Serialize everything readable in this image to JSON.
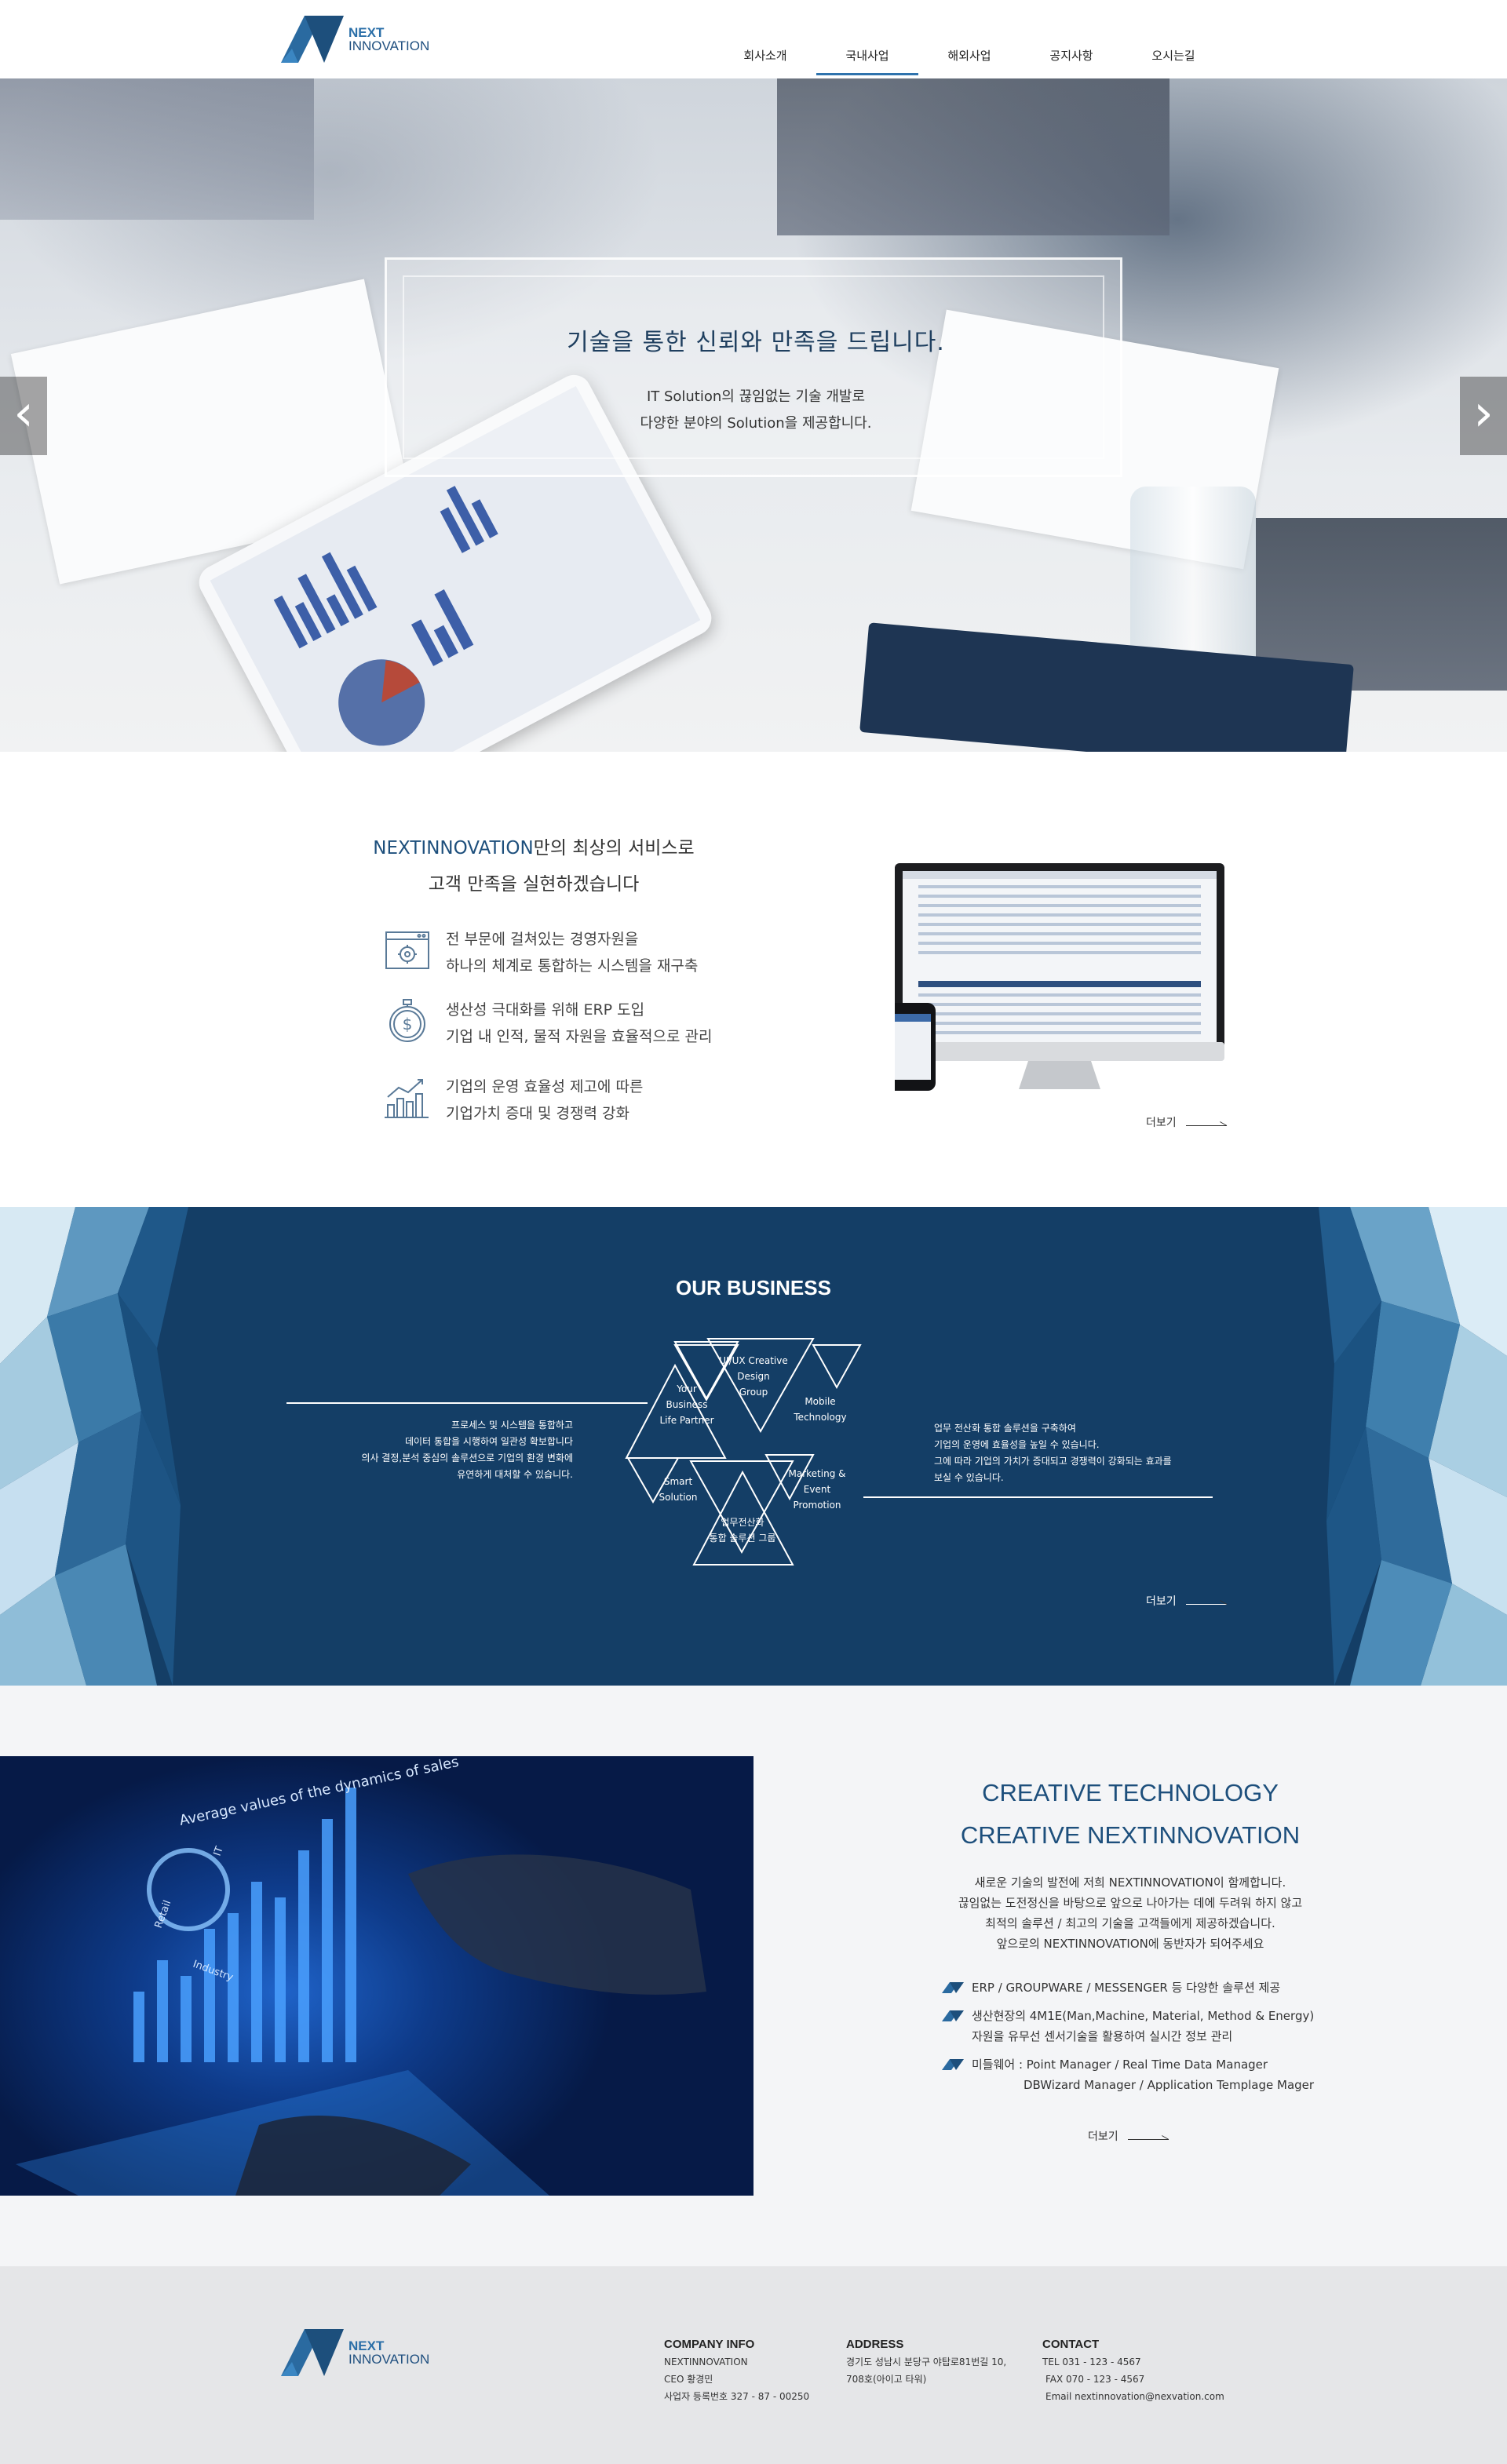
{
  "header": {
    "logo": {
      "line1": "NEXT",
      "line2": "INNOVATION"
    },
    "nav": [
      {
        "label": "회사소개"
      },
      {
        "label": "국내사업"
      },
      {
        "label": "해외사업"
      },
      {
        "label": "공지사항"
      },
      {
        "label": "오시는길"
      }
    ],
    "active_index": 1
  },
  "hero": {
    "title": "기술을 통한 신뢰와 만족을 드립니다.",
    "sub_line1": "IT Solution의 끊임없는 기술 개발로",
    "sub_line2": "다양한 분야의 Solution을 제공합니다.",
    "prev_arrow": "‹",
    "next_arrow": "›"
  },
  "section2": {
    "heading_accent": "NEXTINNOVATION",
    "heading_rest": "만의 최상의 서비스로",
    "heading_line2": "고객 만족을 실현하겠습니다",
    "features": [
      {
        "icon": "browser-settings-icon",
        "line1": "전 부문에 걸쳐있는 경영자원을",
        "line2": "하나의 체계로 통합하는 시스템을 재구축"
      },
      {
        "icon": "stopwatch-dollar-icon",
        "line1": "생산성 극대화를 위해 ERP 도입",
        "line2": "기업 내 인적, 물적 자원을 효율적으로 관리"
      },
      {
        "icon": "bar-chart-growth-icon",
        "line1": "기업의 운영 효율성 제고에 따른",
        "line2": "기업가치 증대 및 경쟁력 강화"
      }
    ],
    "more": "더보기"
  },
  "section3": {
    "title": "OUR BUSINESS",
    "left_text": [
      "프로세스 및 시스템을 통합하고",
      "데이터 통합을 시행하여 일관성 확보합니다",
      "의사 결정,분석 중심의 솔루션으로 기업의 환경 변화에",
      "유연하게 대처할 수 있습니다."
    ],
    "right_text": [
      "업무 전산화 통합 솔루션을 구축하여",
      "기업의 운영에 효율성을 높일 수 있습니다.",
      "그에 따라 기업의 가치가 증대되고 경쟁력이 강화되는 효과를",
      "보실 수 있습니다."
    ],
    "triangles": [
      {
        "lines": [
          "Your",
          "Business",
          "Life Partner"
        ]
      },
      {
        "lines": [
          "UI/UX  Creative",
          "Design",
          "Group"
        ]
      },
      {
        "lines": [
          "Mobile",
          "Technology"
        ]
      },
      {
        "lines": [
          "Smart",
          "Solution"
        ]
      },
      {
        "lines": [
          "업무전산화",
          "통합 솔루션 그룹"
        ]
      },
      {
        "lines": [
          "Marketing &",
          "Event",
          "Promotion"
        ]
      }
    ],
    "more": "더보기"
  },
  "section4": {
    "title_line1": "CREATIVE TECHNOLOGY",
    "title_line2": "CREATIVE NEXTINNOVATION",
    "para": [
      "새로운 기술의 발전에 저희 NEXTINNOVATION이 함께합니다.",
      "끊임없는 도전정신을 바탕으로 앞으로 나아가는 데에 두려워 하지 않고",
      "최적의 솔루션 / 최고의 기술을 고객들에게 제공하겠습니다.",
      "앞으로의 NEXTINNOVATION에 동반자가 되어주세요"
    ],
    "items": [
      {
        "line1": "ERP / GROUPWARE / MESSENGER 등 다양한 솔루션 제공",
        "line2": ""
      },
      {
        "line1": "생산현장의 4M1E(Man,Machine, Material, Method & Energy)",
        "line2": "자원을 유무선 센서기술을 활용하여 실시간 정보 관리"
      },
      {
        "line1": "미들웨어 : Point Manager / Real Time Data Manager",
        "line2": "DBWizard Manager / Application Templage Mager"
      }
    ],
    "image_texts": {
      "chart_title": "Average values of the dynamics of sales",
      "retail": "Retail",
      "industry": "Industry",
      "it": "IT"
    },
    "more": "더보기"
  },
  "footer": {
    "logo": {
      "line1": "NEXT",
      "line2": "INNOVATION"
    },
    "company": {
      "title": "COMPANY INFO",
      "lines": [
        "NEXTINNOVATION",
        "CEO 황경민",
        "사업자 등록번호 327 - 87 - 00250"
      ]
    },
    "address": {
      "title": "ADDRESS",
      "lines": [
        "경기도 성남시 분당구 야탑로81번길 10,",
        "708호(아이고 타워)"
      ]
    },
    "contact": {
      "title": "CONTACT",
      "lines": [
        "TEL 031 - 123 - 4567",
        "FAX 070 - 123 - 4567",
        "Email nextinnovation@nexvation.com"
      ]
    }
  },
  "colors": {
    "brand": "#1d4f7c",
    "accent": "#2f73ad",
    "section_blue": "#143e66",
    "footer_bg": "#e5e6e8"
  }
}
